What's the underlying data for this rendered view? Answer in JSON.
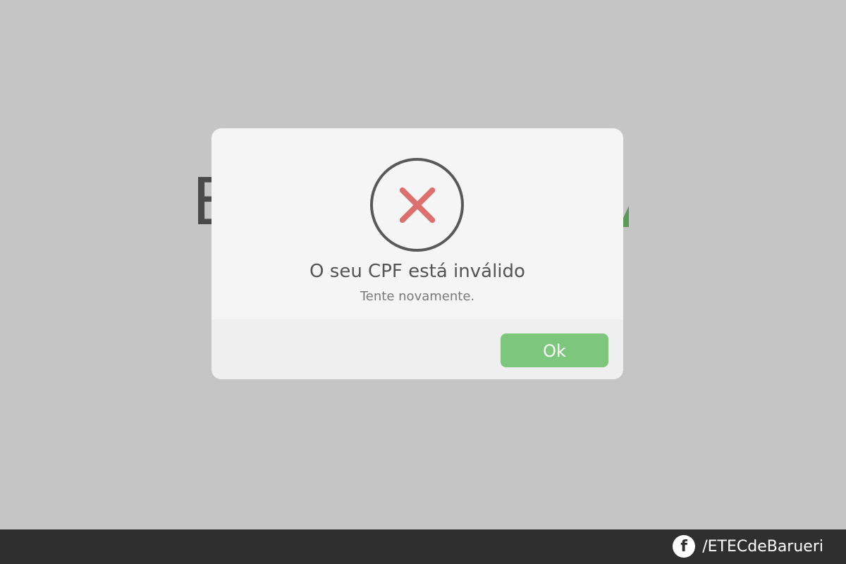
{
  "background": {
    "heading_visible_left": "E",
    "colors": {
      "page_bg": "#c5c5c5",
      "heading_text": "#4a4a4a",
      "heading_accent": "#5a9b5c"
    }
  },
  "dialog": {
    "icon": "error-x-icon",
    "title": "O seu CPF está inválido",
    "text": "Tente novamente.",
    "ok_label": "Ok",
    "colors": {
      "dialog_bg": "#f5f5f5",
      "footer_bg": "#efefef",
      "icon_ring": "#595959",
      "icon_x": "#dd6f6f",
      "ok_button": "#7cc77c"
    }
  },
  "footer": {
    "social_icon": "facebook-icon",
    "social_glyph": "f",
    "social_label": "/ETECdeBarueri",
    "colors": {
      "footer_bg": "#2f2f2f"
    }
  }
}
